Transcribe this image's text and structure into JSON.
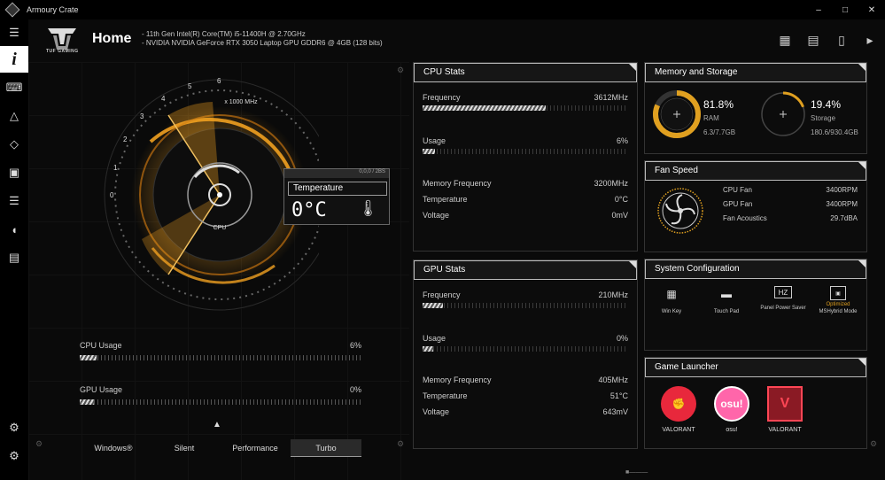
{
  "window": {
    "title": "Armoury Crate"
  },
  "header": {
    "brand": "TUF GAMING",
    "title": "Home",
    "specs": [
      "11th Gen Intel(R) Core(TM) i5-11400H @ 2.70GHz",
      "NVIDIA NVIDIA GeForce RTX 3050 Laptop GPU GDDR6 @ 4GB (128 bits)"
    ]
  },
  "gauge": {
    "scale_label": "x 1000 MHz",
    "ticks": [
      "0",
      "1",
      "2",
      "3",
      "4",
      "5",
      "6"
    ],
    "center_label": "CPU",
    "temperature_label": "Temperature",
    "temperature_value": "0°C",
    "box_code": "0,0,0 / 2BS"
  },
  "left_usage": [
    {
      "label": "CPU Usage",
      "value": "6%",
      "fill": 0.06
    },
    {
      "label": "GPU Usage",
      "value": "0%",
      "fill": 0.0
    }
  ],
  "modes": [
    "Windows®",
    "Silent",
    "Performance",
    "Turbo"
  ],
  "cpu_stats": {
    "title": "CPU Stats",
    "frequency": {
      "label": "Frequency",
      "value": "3612MHz",
      "fill": 0.6
    },
    "usage": {
      "label": "Usage",
      "value": "6%",
      "fill": 0.06
    },
    "mem_freq": {
      "label": "Memory Frequency",
      "value": "3200MHz"
    },
    "temperature": {
      "label": "Temperature",
      "value": "0°C"
    },
    "voltage": {
      "label": "Voltage",
      "value": "0mV"
    }
  },
  "gpu_stats": {
    "title": "GPU Stats",
    "frequency": {
      "label": "Frequency",
      "value": "210MHz",
      "fill": 0.1
    },
    "usage": {
      "label": "Usage",
      "value": "0%",
      "fill": 0.0
    },
    "mem_freq": {
      "label": "Memory Frequency",
      "value": "405MHz"
    },
    "temperature": {
      "label": "Temperature",
      "value": "51°C"
    },
    "voltage": {
      "label": "Voltage",
      "value": "643mV"
    }
  },
  "memory": {
    "title": "Memory and Storage",
    "ram_percent": "81.8%",
    "ram_label": "RAM",
    "ram_detail": "6.3/7.7GB",
    "ram_fill": 0.818,
    "storage_percent": "19.4%",
    "storage_label": "Storage",
    "storage_detail": "180.6/930.4GB",
    "storage_fill": 0.194
  },
  "fan": {
    "title": "Fan Speed",
    "rows": [
      {
        "label": "CPU Fan",
        "value": "3400RPM"
      },
      {
        "label": "GPU Fan",
        "value": "3400RPM"
      },
      {
        "label": "Fan Acoustics",
        "value": "29.7dBA"
      }
    ]
  },
  "sysconfig": {
    "title": "System Configuration",
    "items": [
      {
        "label": "Win Key",
        "sub": "",
        "icon": "windows-icon"
      },
      {
        "label": "Touch Pad",
        "sub": "",
        "icon": "touchpad-icon"
      },
      {
        "label": "Panel Power Saver",
        "sub": "",
        "icon": "hz-icon"
      },
      {
        "label": "MSHybrid Mode",
        "sub": "Optimized",
        "icon": "gpu-mode-icon"
      }
    ]
  },
  "games": {
    "title": "Game Launcher",
    "items": [
      {
        "label": "VALORANT",
        "glyph": "",
        "color": "#e8283c"
      },
      {
        "label": "osu!",
        "glyph": "osu!",
        "color": "#ff66aa"
      },
      {
        "label": "VALORANT",
        "glyph": "V",
        "color": "#ff4655"
      }
    ]
  },
  "colors": {
    "accent": "#f0a020",
    "panel_border": "#bbbbbb"
  }
}
